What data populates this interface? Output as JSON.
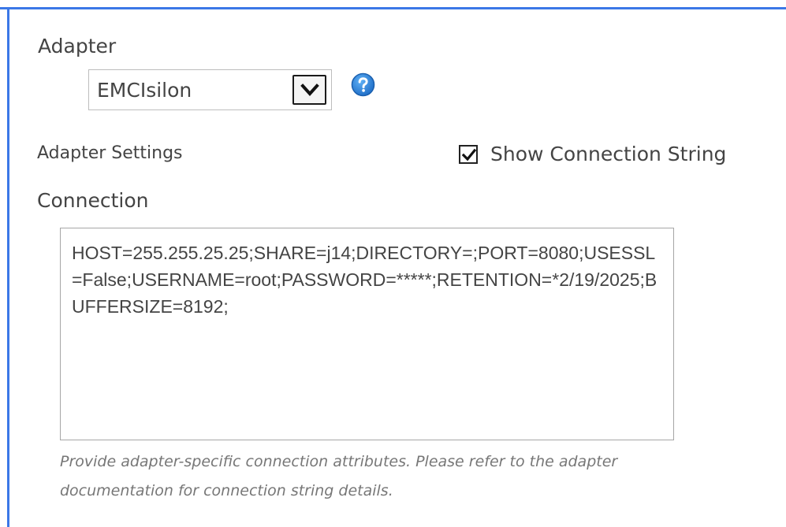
{
  "adapter": {
    "label": "Adapter",
    "selected_value": "EMCIsilon",
    "help_icon": "question-circle-icon"
  },
  "adapter_settings": {
    "label": "Adapter Settings",
    "show_connection_string": {
      "label": "Show Connection String",
      "checked": true
    }
  },
  "connection": {
    "label": "Connection",
    "value": "HOST=255.255.25.25;SHARE=j14;DIRECTORY=;PORT=8080;USESSL=False;USERNAME=root;PASSWORD=*****;RETENTION=*2/19/2025;BUFFERSIZE=8192;",
    "help_text": "Provide adapter-specific connection attributes. Please refer to the adapter documentation for connection string details."
  },
  "colors": {
    "accent_border": "#3b78e7",
    "help_icon": "#2c7fd6",
    "text": "#444444",
    "muted_text": "#777777"
  }
}
